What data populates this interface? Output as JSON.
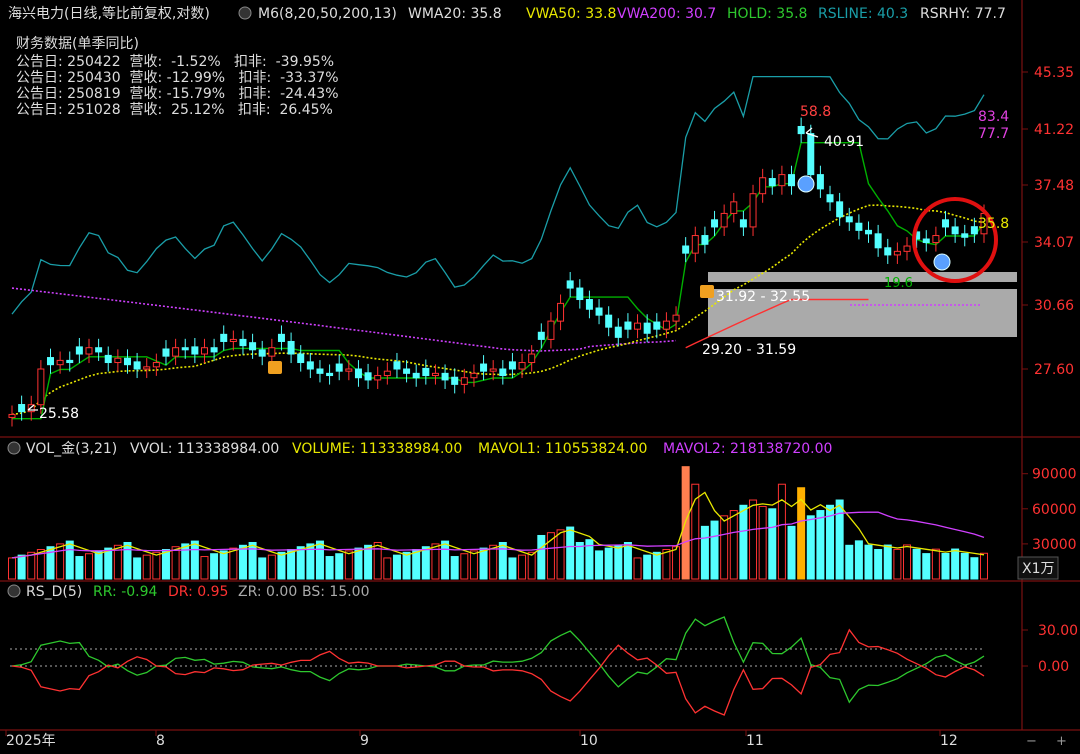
{
  "header": {
    "stock": "海兴电力(日线,等比前复权,对数)",
    "ma_name": "M6(8,20,50,200,13)",
    "wma20": "WMA20: 35.8",
    "vwa50": "VWA50: 33.8",
    "vwa200": "VWA200: 30.7",
    "hold": "HOLD: 35.8",
    "rsline": "RSLINE: 40.3",
    "rsrhy": "RSRHY: 77.7"
  },
  "finance": {
    "title": "财务数据(单季同比)",
    "rows": [
      "公告日: 250422  营收:  -1.52%   扣非:  -39.95%",
      "公告日: 250430  营收: -12.99%   扣非:  -33.37%",
      "公告日: 250819  营收: -15.79%   扣非:  -24.43%",
      "公告日: 251028  营收:  25.12%   扣非:  26.45%"
    ]
  },
  "price_axis": [
    "45.35",
    "41.22",
    "37.48",
    "34.07",
    "30.66",
    "27.60"
  ],
  "price_labels": {
    "low": "25.58",
    "high_mark": "40.91",
    "rs_high": "58.8",
    "rs_right_1": "83.4",
    "rs_right_2": "77.7",
    "hold_right": "35.8",
    "zone_upper": "31.92 - 32.55",
    "zone_lower": "29.20 - 31.59",
    "bottom_green": "19.6"
  },
  "volume": {
    "title": "VOL_金(3,21)",
    "vvol": "VVOL: 113338984.00",
    "volume": "VOLUME: 113338984.00",
    "mavol1": "MAVOL1: 110553824.00",
    "mavol2": "MAVOL2: 218138720.00",
    "axis": [
      "90000",
      "60000",
      "30000"
    ],
    "unit": "X1万"
  },
  "rs": {
    "title": "RS_D(5)",
    "rr": "RR: -0.94",
    "dr": "DR: 0.95",
    "zr": "ZR: 0.00",
    "bs": "BS: 15.00",
    "axis": [
      "30.00",
      "0.00"
    ]
  },
  "time_axis": [
    "2025年",
    "8",
    "9",
    "10",
    "11",
    "12"
  ],
  "colors": {
    "up": "#ff3232",
    "down": "#54ffff",
    "yellow": "#e8e800",
    "purple": "#d040ff",
    "green": "#00b000",
    "teal": "#1a9ea8",
    "circle": "#e01010",
    "orange": "#ff7f50",
    "gold": "#ffb000"
  },
  "chart_data": {
    "type": "candlestick",
    "title": "海兴电力 日线",
    "ylim": [
      25.0,
      46.5
    ],
    "y_ticks": [
      45.35,
      41.22,
      37.48,
      34.07,
      30.66,
      27.6
    ],
    "x_ticks": [
      "2025年",
      "8",
      "9",
      "10",
      "11",
      "12"
    ],
    "close_approx": [
      25.58,
      25.7,
      26.0,
      27.6,
      27.8,
      28.0,
      27.9,
      28.3,
      28.6,
      28.4,
      27.9,
      28.1,
      27.8,
      27.6,
      27.7,
      27.9,
      28.2,
      28.6,
      28.5,
      28.3,
      28.6,
      28.4,
      28.9,
      29.0,
      28.7,
      28.5,
      28.2,
      28.6,
      28.9,
      28.3,
      27.9,
      27.6,
      27.4,
      27.3,
      27.5,
      27.6,
      27.2,
      27.1,
      27.3,
      27.5,
      27.6,
      27.4,
      27.2,
      27.3,
      27.4,
      27.1,
      26.9,
      27.2,
      27.4,
      27.5,
      27.6,
      27.3,
      27.6,
      27.9,
      28.3,
      29.0,
      29.9,
      30.8,
      31.6,
      31.0,
      30.5,
      30.2,
      29.6,
      29.1,
      29.5,
      29.8,
      29.3,
      29.5,
      29.9,
      30.2,
      33.5,
      34.5,
      34.0,
      35.0,
      35.8,
      36.5,
      35.0,
      37.0,
      38.0,
      37.5,
      38.2,
      37.5,
      40.91,
      38.2,
      37.3,
      36.5,
      35.6,
      35.3,
      34.8,
      34.6,
      33.8,
      33.4,
      33.6,
      33.9,
      34.3,
      34.1,
      34.5,
      35.0,
      34.6,
      34.4,
      34.6,
      35.8
    ],
    "rsline": [
      40.3
    ],
    "volume_unit": "万",
    "mavol_axis": [
      90000,
      60000,
      30000
    ],
    "rs_axis": [
      30.0,
      0.0
    ]
  }
}
